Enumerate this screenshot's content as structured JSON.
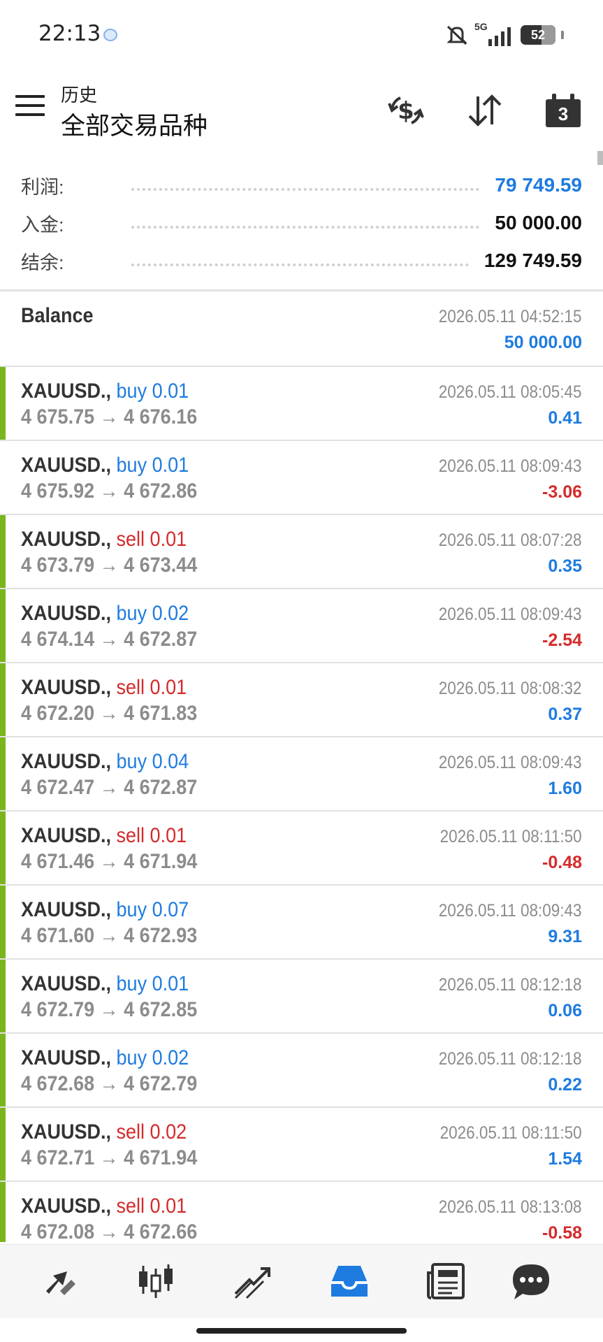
{
  "status_bar": {
    "time": "22:13",
    "network": "5G",
    "battery": "52"
  },
  "header": {
    "subtitle": "历史",
    "title": "全部交易品种",
    "calendar_day": "3"
  },
  "summary": {
    "profit_label": "利润:",
    "profit_value": "79 749.59",
    "deposit_label": "入金:",
    "deposit_value": "50 000.00",
    "balance_label": "结余:",
    "balance_value": "129 749.59"
  },
  "balance_entry": {
    "label": "Balance",
    "time": "2026.05.11 04:52:15",
    "amount": "50 000.00"
  },
  "deals": [
    {
      "symbol": "XAUUSD.,",
      "action": "buy 0.01",
      "side": "buy",
      "open": "4 675.75",
      "close": "4 676.16",
      "time": "2026.05.11 08:05:45",
      "profit": "0.41",
      "bar": true
    },
    {
      "symbol": "XAUUSD.,",
      "action": "buy 0.01",
      "side": "buy",
      "open": "4 675.92",
      "close": "4 672.86",
      "time": "2026.05.11 08:09:43",
      "profit": "-3.06",
      "bar": false
    },
    {
      "symbol": "XAUUSD.,",
      "action": "sell 0.01",
      "side": "sell",
      "open": "4 673.79",
      "close": "4 673.44",
      "time": "2026.05.11 08:07:28",
      "profit": "0.35",
      "bar": true
    },
    {
      "symbol": "XAUUSD.,",
      "action": "buy 0.02",
      "side": "buy",
      "open": "4 674.14",
      "close": "4 672.87",
      "time": "2026.05.11 08:09:43",
      "profit": "-2.54",
      "bar": true
    },
    {
      "symbol": "XAUUSD.,",
      "action": "sell 0.01",
      "side": "sell",
      "open": "4 672.20",
      "close": "4 671.83",
      "time": "2026.05.11 08:08:32",
      "profit": "0.37",
      "bar": true
    },
    {
      "symbol": "XAUUSD.,",
      "action": "buy 0.04",
      "side": "buy",
      "open": "4 672.47",
      "close": "4 672.87",
      "time": "2026.05.11 08:09:43",
      "profit": "1.60",
      "bar": true
    },
    {
      "symbol": "XAUUSD.,",
      "action": "sell 0.01",
      "side": "sell",
      "open": "4 671.46",
      "close": "4 671.94",
      "time": "2026.05.11 08:11:50",
      "profit": "-0.48",
      "bar": true
    },
    {
      "symbol": "XAUUSD.,",
      "action": "buy 0.07",
      "side": "buy",
      "open": "4 671.60",
      "close": "4 672.93",
      "time": "2026.05.11 08:09:43",
      "profit": "9.31",
      "bar": true
    },
    {
      "symbol": "XAUUSD.,",
      "action": "buy 0.01",
      "side": "buy",
      "open": "4 672.79",
      "close": "4 672.85",
      "time": "2026.05.11 08:12:18",
      "profit": "0.06",
      "bar": true
    },
    {
      "symbol": "XAUUSD.,",
      "action": "buy 0.02",
      "side": "buy",
      "open": "4 672.68",
      "close": "4 672.79",
      "time": "2026.05.11 08:12:18",
      "profit": "0.22",
      "bar": true
    },
    {
      "symbol": "XAUUSD.,",
      "action": "sell 0.02",
      "side": "sell",
      "open": "4 672.71",
      "close": "4 671.94",
      "time": "2026.05.11 08:11:50",
      "profit": "1.54",
      "bar": true
    },
    {
      "symbol": "XAUUSD.,",
      "action": "sell 0.01",
      "side": "sell",
      "open": "4 672.08",
      "close": "4 672.66",
      "time": "2026.05.11 08:13:08",
      "profit": "-0.58",
      "bar": true
    }
  ],
  "price_arrow": "→",
  "bottom_nav": [
    "quotes-icon",
    "chart-candles-icon",
    "trade-icon",
    "history-inbox-icon",
    "news-icon",
    "chat-icon"
  ],
  "colors": {
    "blue": "#1e7be0",
    "red": "#d42b2b",
    "green_bar": "#7ab51d",
    "gray_text": "#8c8c8c"
  }
}
